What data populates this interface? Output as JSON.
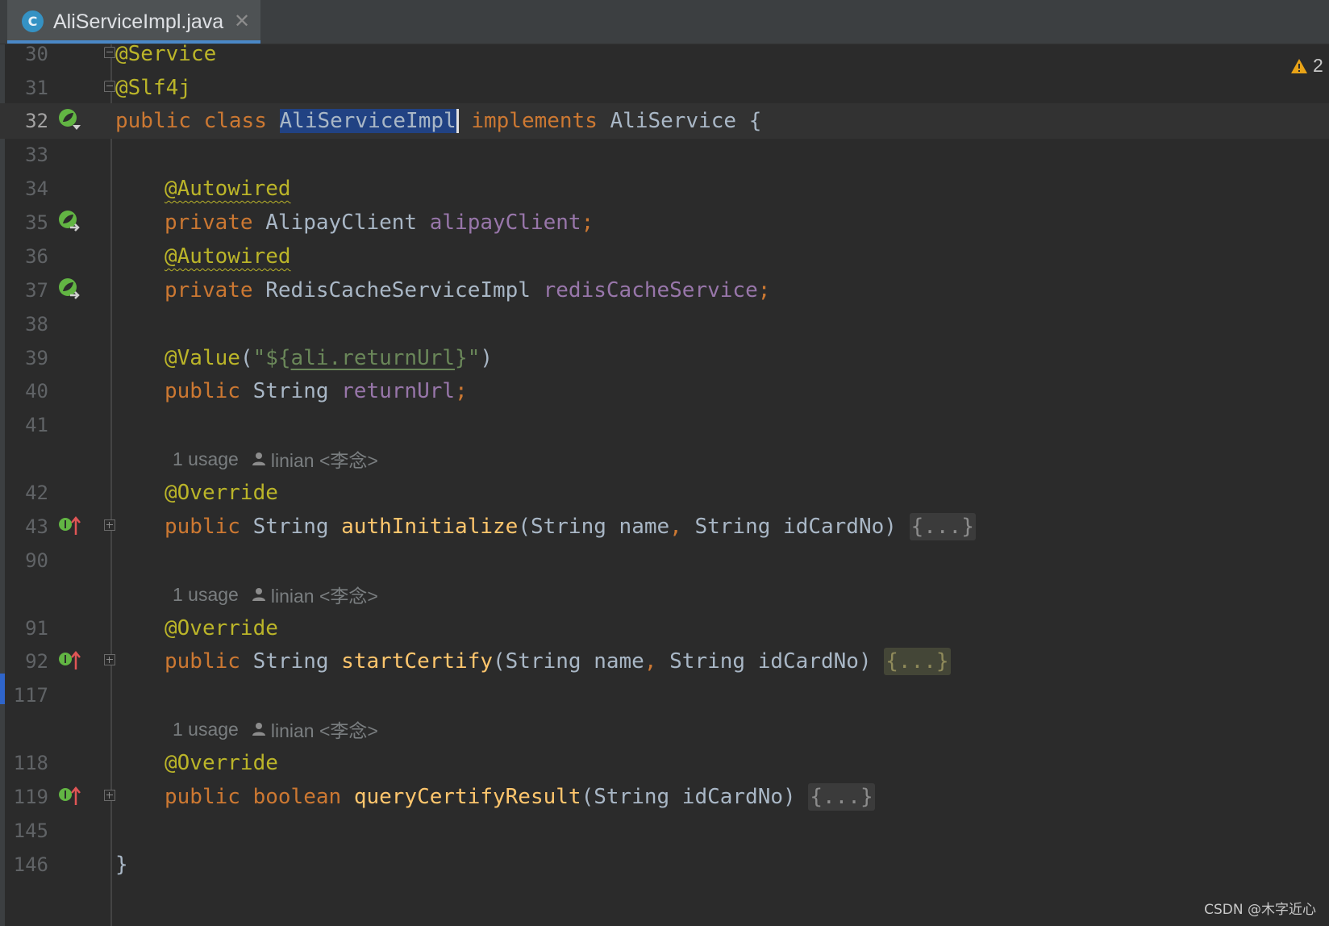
{
  "tab": {
    "icon_letter": "C",
    "label": "AliServiceImpl.java",
    "close_glyph": "✕"
  },
  "warnings": {
    "count": "2",
    "icon": "warning-icon"
  },
  "lines": [
    {
      "no": "30"
    },
    {
      "no": "31"
    },
    {
      "no": "32"
    },
    {
      "no": "33"
    },
    {
      "no": "34"
    },
    {
      "no": "35"
    },
    {
      "no": "36"
    },
    {
      "no": "37"
    },
    {
      "no": "38"
    },
    {
      "no": "39"
    },
    {
      "no": "40"
    },
    {
      "no": "41"
    },
    {
      "no": "42"
    },
    {
      "no": "43"
    },
    {
      "no": "90"
    },
    {
      "no": "91"
    },
    {
      "no": "92"
    },
    {
      "no": "117"
    },
    {
      "no": "118"
    },
    {
      "no": "119"
    },
    {
      "no": "145"
    },
    {
      "no": "146"
    }
  ],
  "hints": [
    {
      "usage": "1 usage",
      "author": "linian <李念>"
    },
    {
      "usage": "1 usage",
      "author": "linian <李念>"
    },
    {
      "usage": "1 usage",
      "author": "linian <李念>"
    }
  ],
  "code": {
    "l30": "@Service",
    "l31": "@Slf4j",
    "l32": {
      "kw1": "public",
      "kw2": "class",
      "cls": "AliServiceImpl",
      "kw3": "implements",
      "iface": "AliService",
      "brace": "{"
    },
    "l34": "@Autowired",
    "l35": {
      "kw": "private",
      "type": "AlipayClient",
      "field": "alipayClient",
      "semi": ";"
    },
    "l36": "@Autowired",
    "l37": {
      "kw": "private",
      "type": "RedisCacheServiceImpl",
      "field": "redisCacheService",
      "semi": ";"
    },
    "l39": {
      "ann": "@Value",
      "open": "(",
      "q1": "\"${",
      "key": "ali.returnUrl",
      "q2": "}\"",
      "close": ")"
    },
    "l40": {
      "kw": "public",
      "type": "String",
      "field": "returnUrl",
      "semi": ";"
    },
    "l42": "@Override",
    "l43": {
      "kw": "public",
      "type": "String",
      "name": "authInitialize",
      "params_a": "(String name",
      "comma": ",",
      "params_b": " String idCardNo)",
      "fold": "{...}"
    },
    "l91": "@Override",
    "l92": {
      "kw": "public",
      "type": "String",
      "name": "startCertify",
      "params_a": "(String name",
      "comma": ",",
      "params_b": " String idCardNo)",
      "fold": "{...}"
    },
    "l118": "@Override",
    "l119": {
      "kw1": "public",
      "kw2": "boolean",
      "name": "queryCertifyResult",
      "params": "(String idCardNo)",
      "fold": "{...}"
    },
    "l146": "}"
  },
  "watermark": "CSDN @木字近心",
  "colors": {
    "keyword": "#cc7832",
    "annotation": "#bbb529",
    "field": "#9876aa",
    "method": "#ffc66d",
    "string": "#6a8759",
    "plain": "#a9b7c6",
    "background": "#2b2b2b"
  }
}
